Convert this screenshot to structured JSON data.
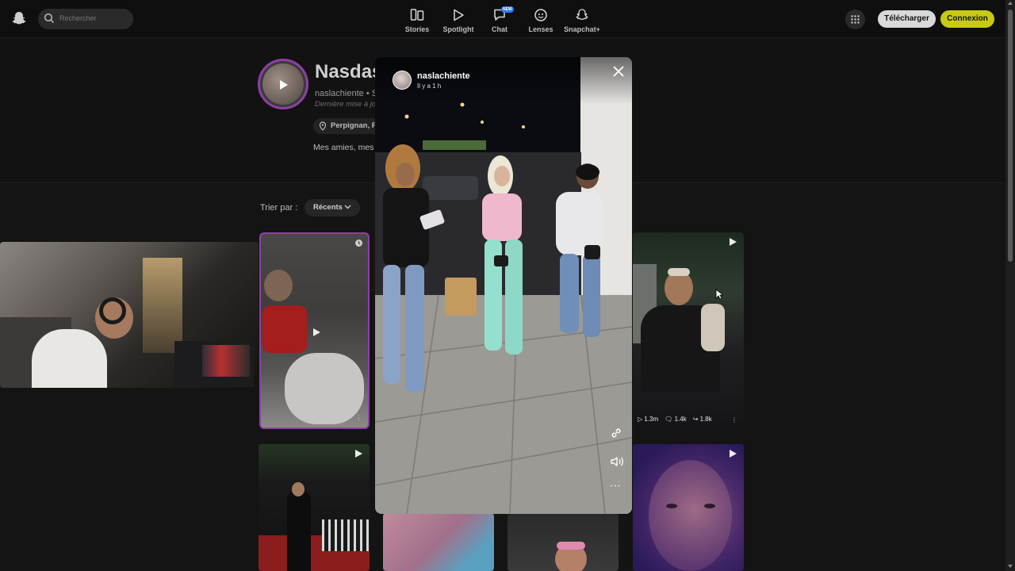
{
  "search": {
    "placeholder": "Rechercher"
  },
  "nav": [
    {
      "label": "Stories",
      "icon": "stories-icon"
    },
    {
      "label": "Spotlight",
      "icon": "spotlight-play-icon"
    },
    {
      "label": "Chat",
      "icon": "chat-icon",
      "badge": "NEW"
    },
    {
      "label": "Lenses",
      "icon": "lenses-icon"
    },
    {
      "label": "Snapchat+",
      "icon": "snapchat-plus-icon"
    }
  ],
  "header": {
    "download_label": "Télécharger",
    "login_label": "Connexion",
    "brand_color": "#c9cb13"
  },
  "profile": {
    "name": "Nasdas",
    "username": "naslachiente • S",
    "updated": "Dernière mise à jo",
    "location": "Perpignan, FR",
    "bio": "Mes amies, mes"
  },
  "sort": {
    "label": "Trier par :",
    "value": "Récents"
  },
  "tiles": [
    {
      "stats": []
    },
    {
      "stats": []
    },
    {
      "stats": [
        "1.3m",
        "1.4k",
        "1.8k"
      ]
    }
  ],
  "modal": {
    "username": "naslachiente",
    "time": "Il y a 1 h",
    "accent_border": "#8e3fa8"
  }
}
